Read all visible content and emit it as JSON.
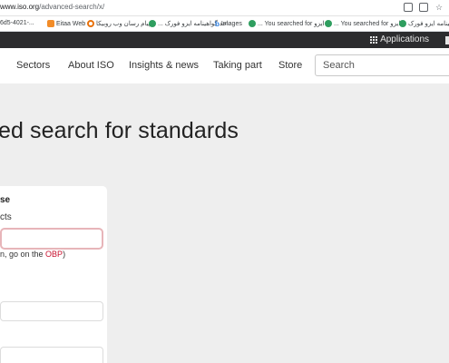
{
  "browser": {
    "url_host": "www.iso.org",
    "url_path": "/advanced-search/x/",
    "icons": [
      "reading-list-icon",
      "install-icon",
      "bookmark-star-icon"
    ]
  },
  "bookmarks": [
    {
      "label": "6d5-4021-...",
      "icon": "none"
    },
    {
      "label": "Eitaa Web",
      "icon": "eitaa-icon"
    },
    {
      "label": "پیام رسان وب روبیکا",
      "icon": "rubika-icon"
    },
    {
      "label": "... احد گواهینامه ایزو فورک",
      "icon": "globe-icon"
    },
    {
      "label": "Images",
      "icon": "bing-icon"
    },
    {
      "label": "... You searched for ایزو",
      "icon": "globe-icon"
    },
    {
      "label": "... You searched for ایزو",
      "icon": "globe-icon"
    },
    {
      "label": "هینامه ایزو فورک",
      "icon": "globe-icon"
    }
  ],
  "topbar": {
    "applications_label": "Applications"
  },
  "nav": {
    "items": [
      "Sectors",
      "About ISO",
      "Insights & news",
      "Taking part",
      "Store"
    ],
    "search_placeholder": "Search"
  },
  "page": {
    "title": "ed search for standards"
  },
  "form": {
    "heading": "se",
    "subheading": "cts",
    "hint_prefix": "n, go on the ",
    "hint_link": "OBP",
    "hint_suffix": ")"
  },
  "colors": {
    "topbar_bg": "#2c2c2e",
    "accent_red": "#c8102e",
    "page_bg": "#eeeeee"
  }
}
